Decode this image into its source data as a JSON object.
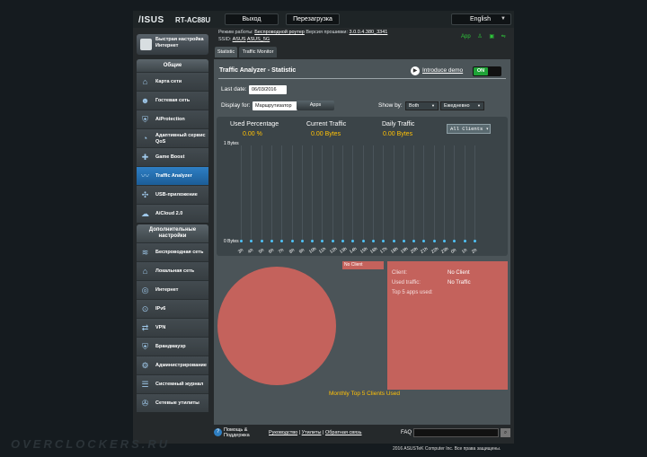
{
  "header": {
    "brand": "/ISUS",
    "model": "RT-AC88U",
    "logout": "Выход",
    "reboot": "Перезагрузка",
    "language": "English"
  },
  "info": {
    "mode_label": "Режим работы:",
    "mode_value": "Беспроводной роутер",
    "fw_label": "Версия прошивки:",
    "fw_value": "3.0.0.4.380_3341",
    "ssid_label": "SSID:",
    "ssid_1": "ASUS",
    "ssid_2": "ASUS_5G",
    "app_label": "App"
  },
  "quick_setup": "Быстрая настройка Интернет",
  "sidebar": {
    "general_header": "Общие",
    "general": [
      {
        "label": "Карта сети",
        "icon": "network-map-icon"
      },
      {
        "label": "Гостевая сеть",
        "icon": "guest-network-icon"
      },
      {
        "label": "AiProtection",
        "icon": "shield-icon"
      },
      {
        "label": "Адаптивный сервис QoS",
        "icon": "qos-icon"
      },
      {
        "label": "Game Boost",
        "icon": "gamepad-icon"
      },
      {
        "label": "Traffic Analyzer",
        "icon": "traffic-icon"
      },
      {
        "label": "USB-приложение",
        "icon": "puzzle-icon"
      },
      {
        "label": "AiCloud 2.0",
        "icon": "cloud-icon"
      }
    ],
    "advanced_header": "Дополнительные настройки",
    "advanced": [
      {
        "label": "Беспроводная сеть",
        "icon": "wifi-icon"
      },
      {
        "label": "Локальная сеть",
        "icon": "home-icon"
      },
      {
        "label": "Интернет",
        "icon": "globe-icon"
      },
      {
        "label": "IPv6",
        "icon": "ipv6-icon"
      },
      {
        "label": "VPN",
        "icon": "vpn-icon"
      },
      {
        "label": "Брандмауэр",
        "icon": "firewall-icon"
      },
      {
        "label": "Администрирование",
        "icon": "admin-icon"
      },
      {
        "label": "Системный журнал",
        "icon": "log-icon"
      },
      {
        "label": "Сетевые утилиты",
        "icon": "tools-icon"
      }
    ]
  },
  "tabs": [
    "Statistic",
    "Traffic Monitor"
  ],
  "page": {
    "title": "Traffic Analyzer - Statistic",
    "intro": "Introduce demo",
    "toggle": "ON",
    "last_date_label": "Last date:",
    "last_date": "06/03/2016",
    "display_for_label": "Display for:",
    "display_for_value": "Маршрутизатор",
    "apps_button": "Apps",
    "show_by_label": "Show by:",
    "show_by_value": "Both",
    "period_value": "Ежедневно"
  },
  "stats": {
    "used_label": "Used Percentage",
    "used_value": "0.00 %",
    "current_label": "Current Traffic",
    "current_value": "0.00 Bytes",
    "daily_label": "Daily Traffic",
    "daily_value": "0.00 Bytes",
    "clients_select": "All Clients"
  },
  "chart_data": {
    "type": "line",
    "y_top_label": "1 Bytes",
    "y_bottom_label": "0 Bytes",
    "x": [
      "3h",
      "4h",
      "5h",
      "6h",
      "7h",
      "8h",
      "9h",
      "10h",
      "11h",
      "12h",
      "13h",
      "14h",
      "15h",
      "16h",
      "17h",
      "18h",
      "19h",
      "20h",
      "21h",
      "22h",
      "23h",
      "0h",
      "1h",
      "2h"
    ],
    "values": [
      0,
      0,
      0,
      0,
      0,
      0,
      0,
      0,
      0,
      0,
      0,
      0,
      0,
      0,
      0,
      0,
      0,
      0,
      0,
      0,
      0,
      0,
      0,
      0
    ]
  },
  "clients": {
    "legend": "No Client",
    "client_label": "Client:",
    "client_value": "No Client",
    "used_traffic_label": "Used traffic:",
    "used_traffic_value": "No Traffic",
    "top_apps_label": "Top 5 apps used:",
    "monthly_title": "Monthly Top 5 Clients Used"
  },
  "footer": {
    "help": "Помощь & Поддержка",
    "manual": "Руководство",
    "utilities": "Утилиты",
    "feedback": "Обратная связь",
    "faq": "FAQ",
    "copyright": "2016 ASUSTeK Computer Inc. Все права защищены."
  },
  "watermark": "OVERCLOCKERS.RU"
}
